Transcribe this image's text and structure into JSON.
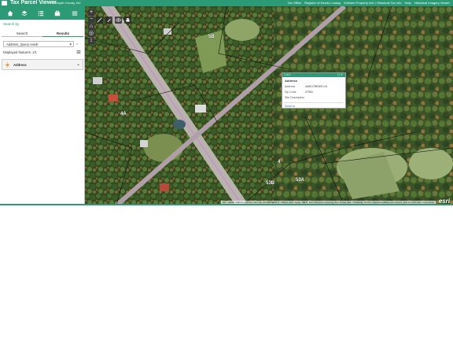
{
  "header": {
    "title": "Tax Parcel Viewer",
    "subtitle": "Forsyth County, NC",
    "links": [
      "Tax Office",
      "Register of Deeds Lookup",
      "Enlisted Property Info / Historical Tax Info",
      "Help",
      "Historical Imagery Viewer"
    ]
  },
  "panel": {
    "label": "Search by",
    "tabs": [
      {
        "label": "Search",
        "active": false
      },
      {
        "label": "Results",
        "active": true
      }
    ],
    "result_select": "Address_Query result",
    "displayed_features": "Displayed features: 1/1",
    "accordion_label": "Address",
    "clear_label": "×"
  },
  "map": {
    "zoom_in": "+",
    "zoom_out": "−",
    "popup": {
      "header": "1 of 1",
      "title": "Address",
      "rows": [
        {
          "label": "Address",
          "value": "4495 CREWS LN"
        },
        {
          "label": "Zip Code",
          "value": "27051"
        },
        {
          "label": "Site Description",
          "value": ""
        }
      ],
      "zoom_to": "Zoom to"
    },
    "parcel_labels": [
      "5B",
      "4",
      "53A",
      "53B",
      "4A"
    ],
    "attribution": "Esri, HERE, Garmin, USGS, Intermap, INCREMENT P, NRCan, Esri Japan, METI, Esri China (Hong Kong), Esri Korea, Esri (Thailand), NGCC, OpenStreetMap contributors, and the GIS User Community",
    "esri_logo": "esri"
  },
  "colors": {
    "brand": "#2b9a75",
    "road_highlight": "#c98bd6"
  }
}
